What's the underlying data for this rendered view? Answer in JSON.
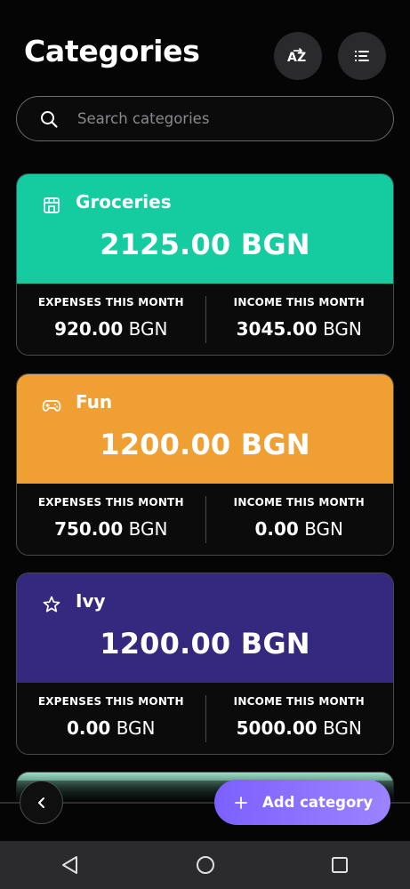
{
  "header": {
    "title": "Categories",
    "sort_button": {
      "label": "AZ",
      "icon": "sort-az-icon"
    },
    "filter_button": {
      "icon": "filter-list-icon"
    }
  },
  "search": {
    "placeholder": "Search categories",
    "value": ""
  },
  "categories": [
    {
      "name": "Groceries",
      "icon": "store-icon",
      "color": "#15cca0",
      "balance": "2125.00 BGN",
      "expenses_label": "EXPENSES THIS MONTH",
      "expenses_amount": "920.00",
      "expenses_currency": "BGN",
      "income_label": "INCOME THIS MONTH",
      "income_amount": "3045.00",
      "income_currency": "BGN"
    },
    {
      "name": "Fun",
      "icon": "gamepad-icon",
      "color": "#f0a032",
      "balance": "1200.00 BGN",
      "expenses_label": "EXPENSES THIS MONTH",
      "expenses_amount": "750.00",
      "expenses_currency": "BGN",
      "income_label": "INCOME THIS MONTH",
      "income_amount": "0.00",
      "income_currency": "BGN"
    },
    {
      "name": "Ivy",
      "icon": "star-icon",
      "color": "#35287f",
      "balance": "1200.00 BGN",
      "expenses_label": "EXPENSES THIS MONTH",
      "expenses_amount": "0.00",
      "expenses_currency": "BGN",
      "income_label": "INCOME THIS MONTH",
      "income_amount": "5000.00",
      "income_currency": "BGN"
    }
  ],
  "bottom_bar": {
    "back_icon": "chevron-left-icon",
    "add_button_label": "Add category",
    "add_icon": "plus-icon",
    "accent_color": "#8a6fff"
  },
  "system_nav": {
    "back_icon": "triangle-back-icon",
    "home_icon": "circle-home-icon",
    "recents_icon": "square-recents-icon",
    "background": "#2b2b2d"
  }
}
